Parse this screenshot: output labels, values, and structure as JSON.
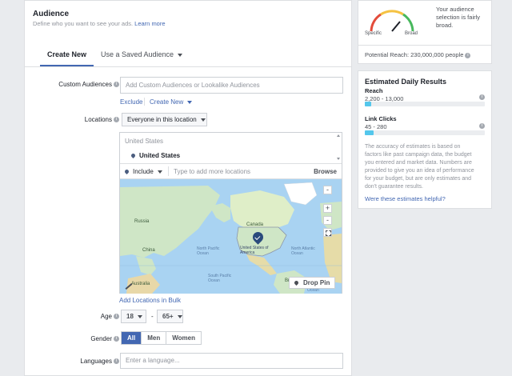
{
  "audience": {
    "title": "Audience",
    "subtitle": "Define who you want to see your ads.",
    "learn_more": "Learn more",
    "tabs": {
      "create_new": "Create New",
      "saved": "Use a Saved Audience"
    },
    "custom_audiences": {
      "label": "Custom Audiences",
      "placeholder": "Add Custom Audiences or Lookalike Audiences",
      "exclude": "Exclude",
      "create_new": "Create New"
    },
    "locations": {
      "label": "Locations",
      "dropdown": "Everyone in this location",
      "group": "United States",
      "selected": "United States",
      "include": "Include",
      "placeholder": "Type to add more locations",
      "browse": "Browse",
      "drop_pin": "Drop Pin",
      "add_bulk": "Add Locations in Bulk",
      "map_labels": {
        "russia": "Russia",
        "china": "China",
        "canada": "Canada",
        "usa": "United States of America",
        "north_pacific": "North Pacific Ocean",
        "north_atlantic": "North Atlantic Ocean",
        "south_pacific": "South Pacific Ocean",
        "south_atlantic": "South Atlantic Ocean",
        "brazil": "Brazil",
        "australia": "Australia"
      },
      "map_controls": {
        "zoom_in": "+",
        "zoom_out": "-",
        "collapse": "-"
      }
    },
    "age": {
      "label": "Age",
      "min": "18",
      "dash": "-",
      "max": "65+"
    },
    "gender": {
      "label": "Gender",
      "options": [
        "All",
        "Men",
        "Women"
      ],
      "selected": "All"
    },
    "languages": {
      "label": "Languages",
      "placeholder": "Enter a language..."
    }
  },
  "definition": {
    "gauge_specific": "Specific",
    "gauge_broad": "Broad",
    "message": [
      "Your audience",
      "selection is fairly",
      "broad."
    ],
    "potential_reach": "Potential Reach: 230,000,000 people"
  },
  "estimates": {
    "title": "Estimated Daily Results",
    "reach_label": "Reach",
    "reach_value": "2,200 - 13,000",
    "reach_fill": 0.05,
    "clicks_label": "Link Clicks",
    "clicks_value": "45 - 280",
    "clicks_fill": 0.07,
    "note": [
      "The accuracy of estimates is based on",
      "factors like past campaign data, the budget",
      "you entered and market data. Numbers are",
      "provided to give you an idea of performance",
      "for your budget, but are only estimates and",
      "don't guarantee results."
    ],
    "helpful": "Were these estimates helpful?"
  },
  "colors": {
    "accent": "#4267b2",
    "selected_tab": "#4267b2",
    "bar": "#54c7ec",
    "gauge_red": "#e34c3b",
    "gauge_yellow": "#f5c242",
    "gauge_green": "#48b85d"
  }
}
